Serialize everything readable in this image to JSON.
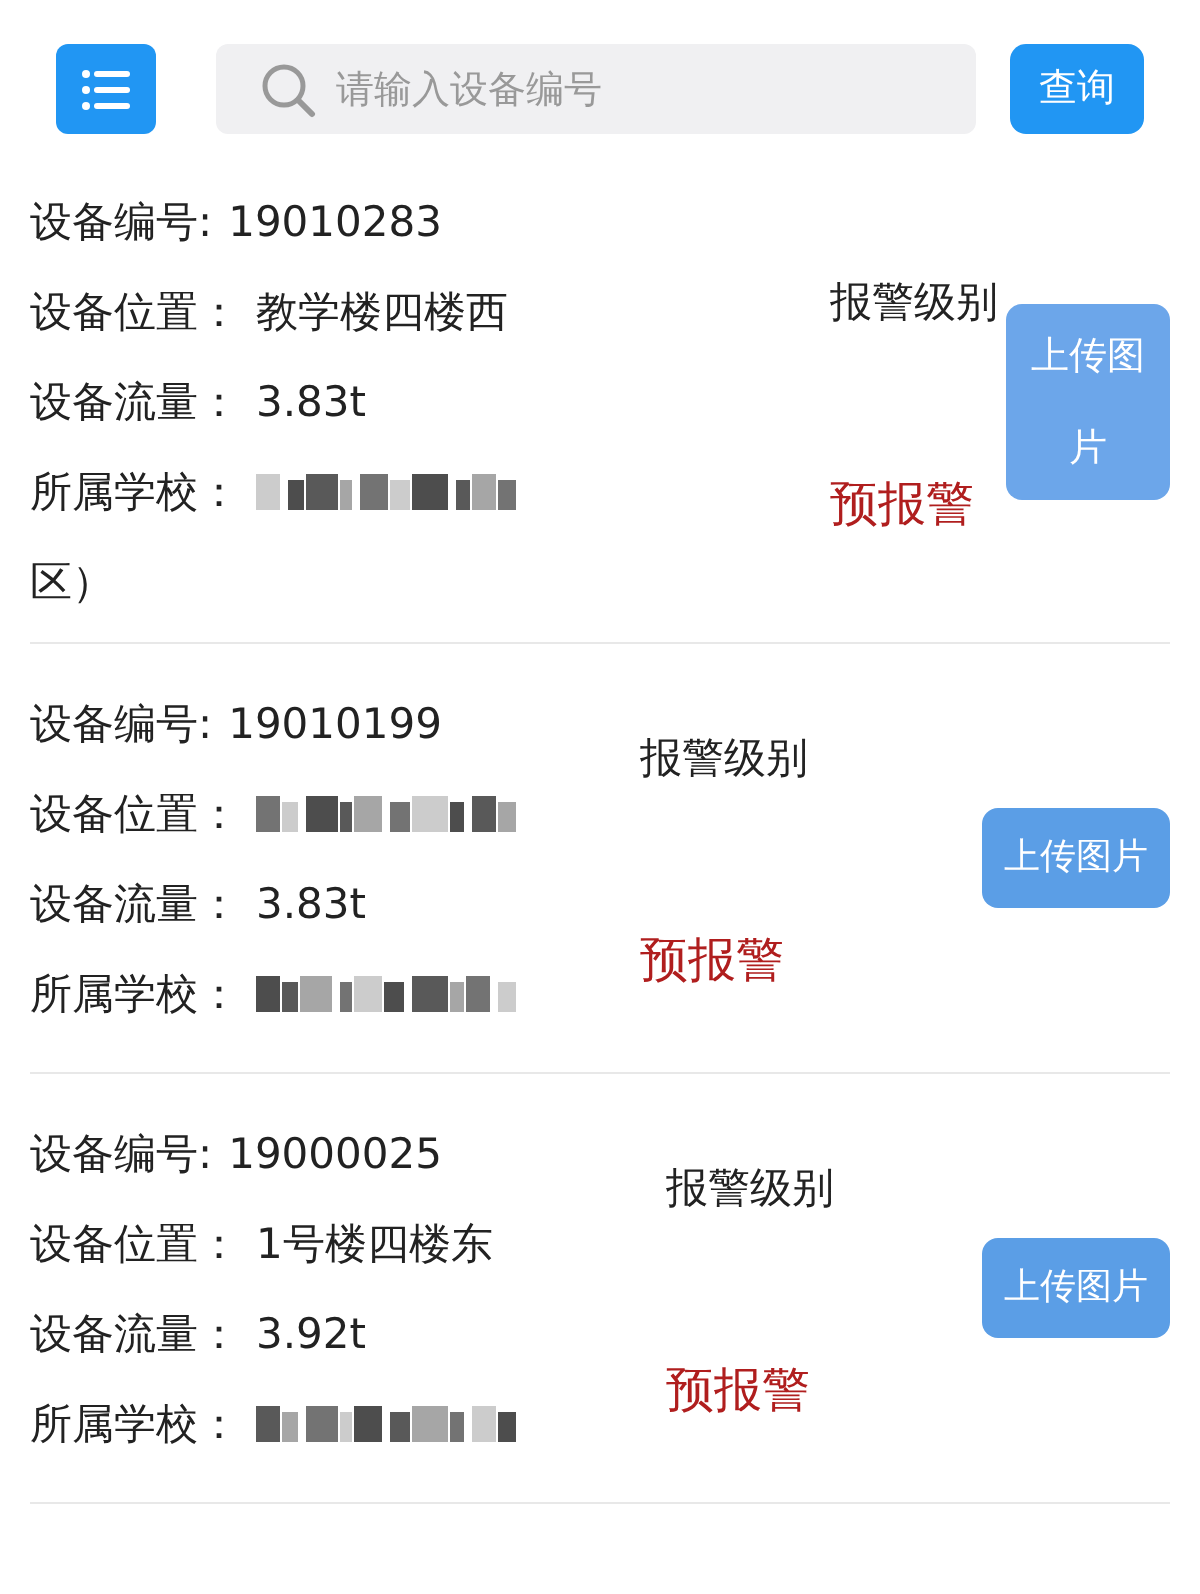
{
  "header": {
    "search": {
      "placeholder": "请输入设备编号"
    },
    "query_button": "查询"
  },
  "devices": [
    {
      "fields": [
        {
          "kind": "text",
          "label": "设备编号:",
          "value": "19010283"
        },
        {
          "kind": "text",
          "label": "设备位置：",
          "value": "教学楼四楼西"
        },
        {
          "kind": "text",
          "label": "设备流量：",
          "value": "3.83t"
        },
        {
          "kind": "redacted",
          "label": "所属学校：",
          "tail": "区）"
        }
      ],
      "alarm_label": "报警级别",
      "alarm_level": "预报警",
      "upload_button": "上传图片"
    },
    {
      "fields": [
        {
          "kind": "text",
          "label": "设备编号:",
          "value": "19010199"
        },
        {
          "kind": "redacted",
          "label": "设备位置："
        },
        {
          "kind": "text",
          "label": "设备流量：",
          "value": "3.83t"
        },
        {
          "kind": "redacted",
          "label": "所属学校："
        }
      ],
      "alarm_label": "报警级别",
      "alarm_level": "预报警",
      "upload_button": "上传图片"
    },
    {
      "fields": [
        {
          "kind": "text",
          "label": "设备编号:",
          "value": "19000025"
        },
        {
          "kind": "text",
          "label": "设备位置：",
          "value": "1号楼四楼东"
        },
        {
          "kind": "text",
          "label": "设备流量：",
          "value": "3.92t"
        },
        {
          "kind": "redacted",
          "label": "所属学校："
        }
      ],
      "alarm_label": "报警级别",
      "alarm_level": "预报警",
      "upload_button": "上传图片"
    }
  ]
}
